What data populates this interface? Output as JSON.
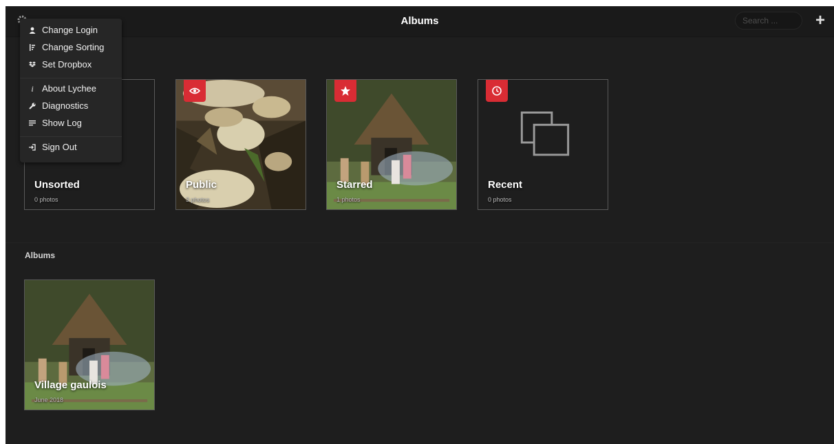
{
  "header": {
    "title": "Albums",
    "search_placeholder": "Search ...",
    "settings_icon": "gear-icon",
    "add_icon": "plus-icon"
  },
  "menu": {
    "items": [
      {
        "label": "Change Login",
        "icon": "user-icon"
      },
      {
        "label": "Change Sorting",
        "icon": "sort-icon"
      },
      {
        "label": "Set Dropbox",
        "icon": "dropbox-icon"
      },
      {
        "label": "About Lychee",
        "icon": "info-icon"
      },
      {
        "label": "Diagnostics",
        "icon": "wrench-icon"
      },
      {
        "label": "Show Log",
        "icon": "list-icon"
      },
      {
        "label": "Sign Out",
        "icon": "sign-out-icon"
      }
    ]
  },
  "smart_albums": [
    {
      "title": "Unsorted",
      "count": "0 photos",
      "badge": ""
    },
    {
      "title": "Public",
      "count": "3 photos",
      "badge": "eye-icon"
    },
    {
      "title": "Starred",
      "count": "1 photos",
      "badge": "star-icon"
    },
    {
      "title": "Recent",
      "count": "0 photos",
      "badge": "clock-icon"
    }
  ],
  "albums_section": {
    "heading": "Albums",
    "albums": [
      {
        "title": "Village gaulois",
        "date": "June 2018"
      }
    ]
  },
  "colors": {
    "background": "#1e1e1e",
    "badge": "#d92c34"
  }
}
